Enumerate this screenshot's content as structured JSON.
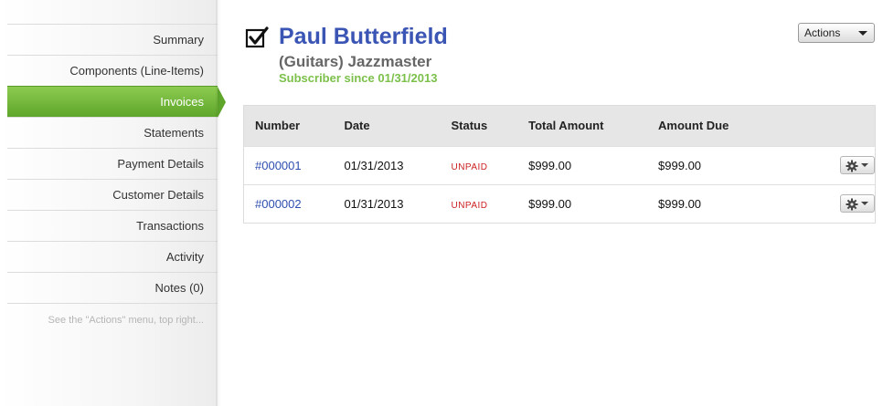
{
  "sidebar": {
    "items": [
      {
        "label": "Summary",
        "active": false
      },
      {
        "label": "Components (Line-Items)",
        "active": false
      },
      {
        "label": "Invoices",
        "active": true
      },
      {
        "label": "Statements",
        "active": false
      },
      {
        "label": "Payment Details",
        "active": false
      },
      {
        "label": "Customer Details",
        "active": false
      },
      {
        "label": "Transactions",
        "active": false
      },
      {
        "label": "Activity",
        "active": false
      },
      {
        "label": "Notes (0)",
        "active": false
      }
    ],
    "hint": "See the \"Actions\" menu, top right..."
  },
  "header": {
    "icon": "checkbox-checked-icon",
    "name": "Paul Butterfield",
    "product": "(Guitars) Jazzmaster",
    "subscriber": "Subscriber since 01/31/2013"
  },
  "actions": {
    "label": "Actions"
  },
  "table": {
    "headers": [
      "Number",
      "Date",
      "Status",
      "Total Amount",
      "Amount Due"
    ],
    "rows": [
      {
        "number": "#000001",
        "date": "01/31/2013",
        "status": "UNPAID",
        "total": "$999.00",
        "due": "$999.00"
      },
      {
        "number": "#000002",
        "date": "01/31/2013",
        "status": "UNPAID",
        "total": "$999.00",
        "due": "$999.00"
      }
    ]
  },
  "colors": {
    "accent_green": "#5ea62b",
    "name_blue": "#3a55b4",
    "status_red": "#cc1f1f",
    "subscriber_green": "#7cc04b"
  }
}
